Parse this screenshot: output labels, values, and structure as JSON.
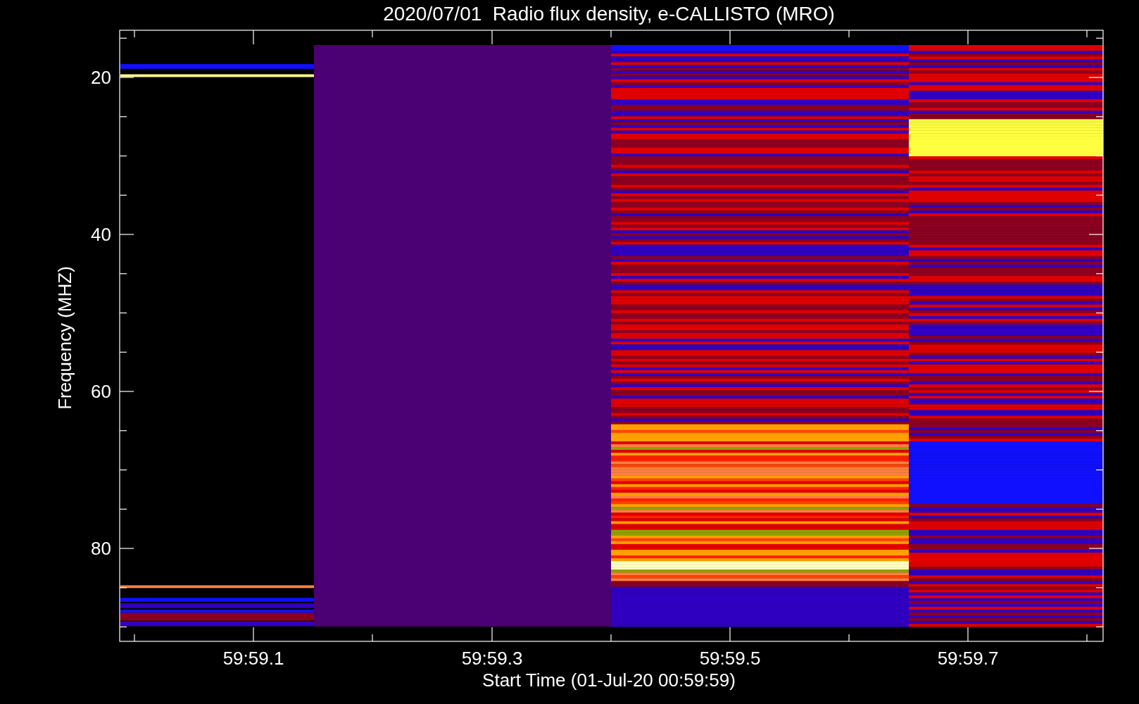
{
  "title": "2020/07/01  Radio flux density, e-CALLISTO (MRO)",
  "y_axis": {
    "label": "Frequency (MHZ)",
    "ticks": [
      "20",
      "40",
      "60",
      "80"
    ]
  },
  "x_axis": {
    "label": "Start Time (01-Jul-20 00:59:59)",
    "ticks": [
      "59:59.1",
      "59:59.3",
      "59:59.5",
      "59:59.7"
    ]
  }
}
